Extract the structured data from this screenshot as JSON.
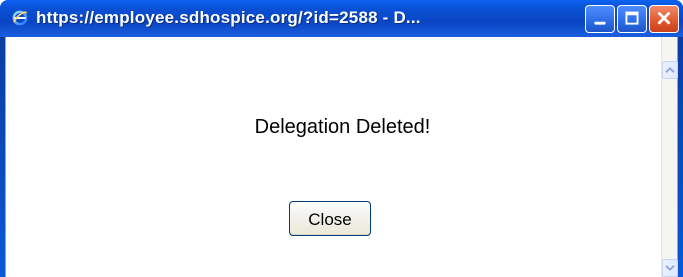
{
  "window": {
    "title": "https://employee.sdhospice.org/?id=2588 - D..."
  },
  "dialog": {
    "message": "Delegation Deleted!",
    "close_label": "Close"
  },
  "icons": {
    "app": "internet-explorer-icon",
    "minimize": "minimize-icon",
    "maximize": "maximize-icon",
    "close": "close-icon",
    "scroll_up": "scroll-up-arrow-icon",
    "scroll_down": "scroll-down-arrow-icon"
  },
  "colors": {
    "titlebar": "#0a45c3",
    "close_button": "#e15a30"
  }
}
